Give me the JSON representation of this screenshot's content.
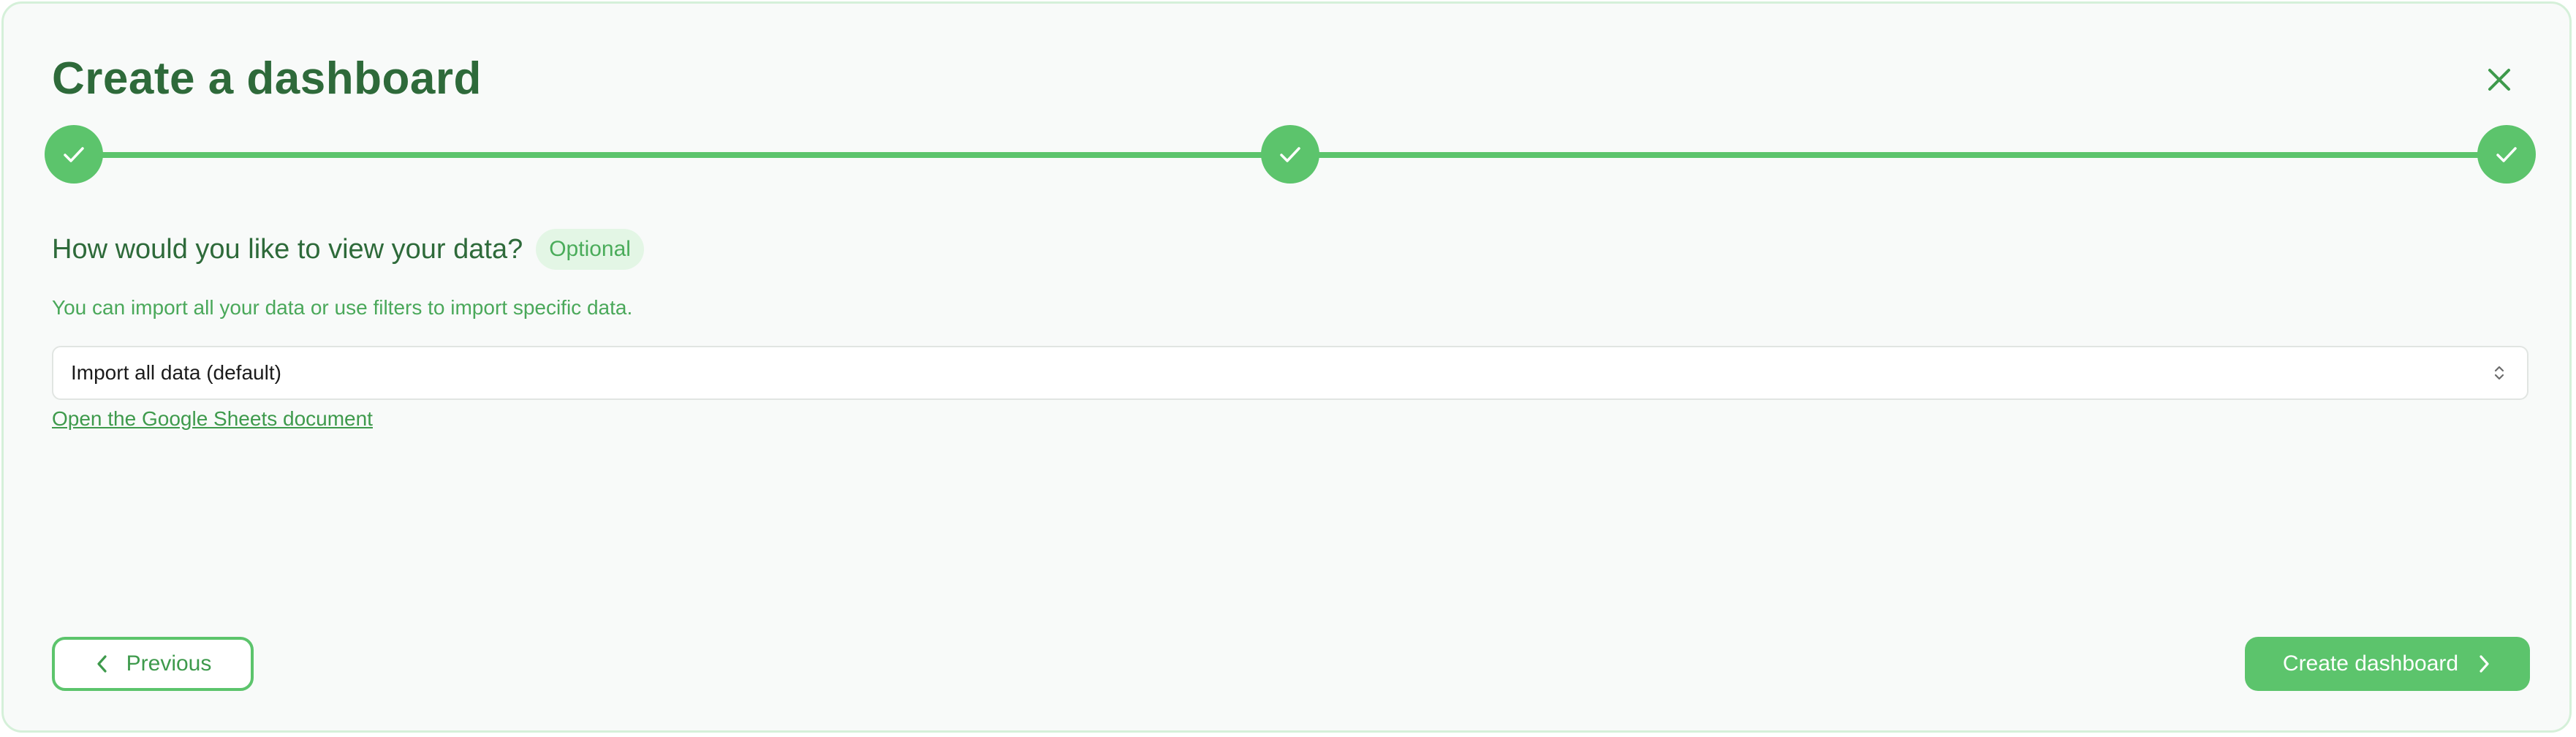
{
  "dialog": {
    "title": "Create a dashboard",
    "close_icon": "close-icon"
  },
  "stepper": {
    "steps": [
      {
        "status": "complete",
        "icon": "check-icon"
      },
      {
        "status": "complete",
        "icon": "check-icon"
      },
      {
        "status": "complete",
        "icon": "check-icon"
      }
    ]
  },
  "form": {
    "question": "How would you like to view your data?",
    "badge": "Optional",
    "helper": "You can import all your data or use filters to import specific data.",
    "select_value": "Import all data (default)",
    "select_icon": "chevron-up-down-icon",
    "link": "Open the Google Sheets document"
  },
  "footer": {
    "previous_label": "Previous",
    "previous_icon": "chevron-left-icon",
    "create_label": "Create dashboard",
    "create_icon": "chevron-right-icon"
  },
  "colors": {
    "accent": "#5cc46c",
    "title": "#2e6a3a",
    "background": "#f8faf9",
    "badge_bg": "#e3f6e5"
  }
}
